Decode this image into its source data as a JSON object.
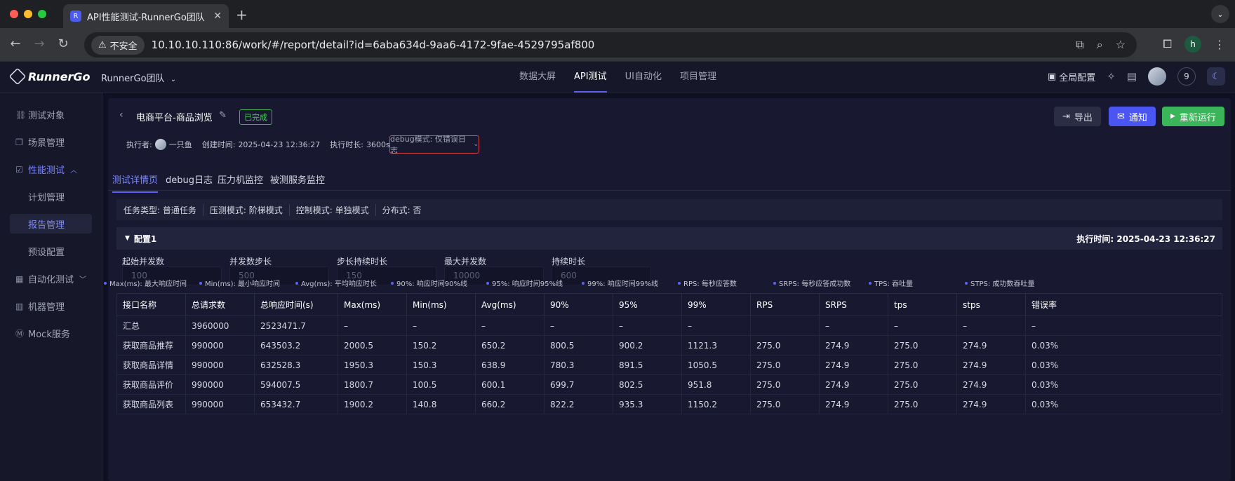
{
  "browser": {
    "tab_title": "API性能测试-RunnerGo团队",
    "insecure_label": "不安全",
    "url": "10.10.10.110:86/work/#/report/detail?id=6aba634d-9aa6-4172-9fae-4529795af800",
    "profile_initial": "h"
  },
  "header": {
    "logo_text": "RunnerGo",
    "team_name": "RunnerGo团队",
    "nav": [
      "数据大屏",
      "API测试",
      "UI自动化",
      "项目管理"
    ],
    "active_nav": "API测试",
    "global_config": "全局配置",
    "notification_count": "9"
  },
  "sidebar": {
    "items": [
      {
        "label": "测试对象",
        "icon": "link-icon"
      },
      {
        "label": "场景管理",
        "icon": "layers-icon"
      },
      {
        "label": "性能测试",
        "icon": "chart-icon",
        "expanded": true
      },
      {
        "label": "计划管理",
        "sub": true
      },
      {
        "label": "报告管理",
        "sub": true,
        "active": true
      },
      {
        "label": "预设配置",
        "sub": true
      },
      {
        "label": "自动化测试",
        "icon": "auto-icon"
      },
      {
        "label": "机器管理",
        "icon": "server-icon"
      },
      {
        "label": "Mock服务",
        "icon": "mock-icon"
      }
    ]
  },
  "report": {
    "title": "电商平台-商品浏览",
    "status": "已完成",
    "export_label": "导出",
    "notify_label": "通知",
    "rerun_label": "重新运行",
    "executor_label": "执行者:",
    "executor_name": "一只鱼",
    "created_label": "创建时间:",
    "created_time": "2025-04-23 12:36:27",
    "duration_label": "执行时长:",
    "duration": "3600s",
    "debug_mode": "debug模式: 仅错误日志"
  },
  "subtabs": [
    "测试详情页",
    "debug日志",
    "压力机监控",
    "被测服务监控"
  ],
  "task_info": {
    "task_type": "任务类型: 普通任务",
    "load_mode": "压测模式: 阶梯模式",
    "control_mode": "控制模式: 单独模式",
    "distributed": "分布式: 否"
  },
  "config": {
    "name": "配置1",
    "exec_time": "执行时间: 2025-04-23 12:36:27",
    "fields": [
      {
        "label": "起始并发数",
        "value": "100"
      },
      {
        "label": "并发数步长",
        "value": "500"
      },
      {
        "label": "步长持续时长",
        "value": "150"
      },
      {
        "label": "最大并发数",
        "value": "10000"
      },
      {
        "label": "持续时长",
        "value": "600"
      }
    ]
  },
  "legend": [
    "Max(ms): 最大响应时间",
    "Min(ms): 最小响应时间",
    "Avg(ms): 平均响应时长",
    "90%: 响应时间90%线",
    "95%: 响应时间95%线",
    "99%: 响应时间99%线",
    "RPS: 每秒应答数",
    "SRPS: 每秒应答成功数",
    "TPS: 吞吐量",
    "STPS: 成功数吞吐量"
  ],
  "table": {
    "columns": [
      "接口名称",
      "总请求数",
      "总响应时间(s)",
      "Max(ms)",
      "Min(ms)",
      "Avg(ms)",
      "90%",
      "95%",
      "99%",
      "RPS",
      "SRPS",
      "tps",
      "stps",
      "错误率"
    ],
    "rows": [
      [
        "汇总",
        "3960000",
        "2523471.7",
        "–",
        "–",
        "–",
        "–",
        "–",
        "–",
        "",
        "–",
        "–",
        "–",
        "–"
      ],
      [
        "获取商品推荐",
        "990000",
        "643503.2",
        "2000.5",
        "150.2",
        "650.2",
        "800.5",
        "900.2",
        "1121.3",
        "275.0",
        "274.9",
        "275.0",
        "274.9",
        "0.03%"
      ],
      [
        "获取商品详情",
        "990000",
        "632528.3",
        "1950.3",
        "150.3",
        "638.9",
        "780.3",
        "891.5",
        "1050.5",
        "275.0",
        "274.9",
        "275.0",
        "274.9",
        "0.03%"
      ],
      [
        "获取商品评价",
        "990000",
        "594007.5",
        "1800.7",
        "100.5",
        "600.1",
        "699.7",
        "802.5",
        "951.8",
        "275.0",
        "274.9",
        "275.0",
        "274.9",
        "0.03%"
      ],
      [
        "获取商品列表",
        "990000",
        "653432.7",
        "1900.2",
        "140.8",
        "660.2",
        "822.2",
        "935.3",
        "1150.2",
        "275.0",
        "274.9",
        "275.0",
        "274.9",
        "0.03%"
      ]
    ]
  },
  "colors": {
    "accent": "#5a64f5",
    "success": "#3bb55a",
    "danger": "#d24a4a"
  }
}
